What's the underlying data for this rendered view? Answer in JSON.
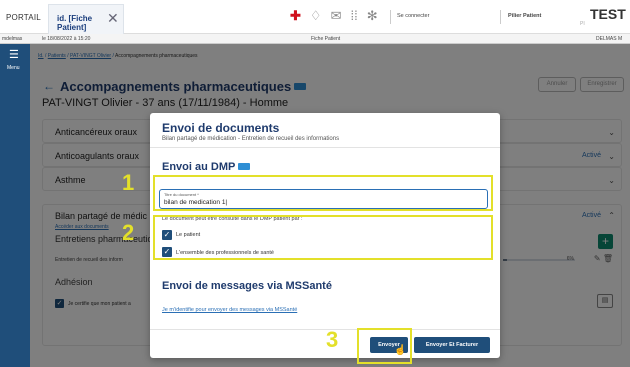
{
  "top": {
    "portail": "PORTAIL",
    "tab_label": "id. [Fiche Patient]",
    "connect": "Se connecter",
    "pilier": "Pilier Patient",
    "brand": "TEST",
    "brand_sub": "PI"
  },
  "strip": {
    "user": "mdelmas",
    "date": "le 18/08/2022 à 15:20",
    "center": "Fiche Patient",
    "right": "DELMAS M"
  },
  "sidebar": {
    "menu_label": "Menu"
  },
  "breadcrumb": {
    "id": "Id.",
    "patients": "Patients",
    "patient": "PAT-VINGT Olivier",
    "current": "Accompagnements pharmaceutiques"
  },
  "page": {
    "title": "Accompagnements pharmaceutiques",
    "patient": "PAT-VINGT Olivier - 37 ans (17/11/1984) - Homme",
    "annuler": "Annuler",
    "enregistrer": "Enregistrer"
  },
  "cards": [
    {
      "title": "Anticancéreux oraux",
      "status": ""
    },
    {
      "title": "Anticoagulants oraux",
      "status": "Activé"
    },
    {
      "title": "Asthme",
      "status": ""
    },
    {
      "title": "Bilan partagé de médic",
      "status": "Activé"
    }
  ],
  "bilan": {
    "acceder": "Accéder aux documents",
    "entretiens": "Entretiens pharmaceutiqu",
    "entretien_row": "Entretien de recueil des inform",
    "progress_percent": 6,
    "pct_label": "6%",
    "adhesion": "Adhésion",
    "certify": "Je certifie que mon patient a"
  },
  "modal": {
    "title": "Envoi de documents",
    "subtitle": "Bilan partagé de médication - Entretien de recueil des informations",
    "dmp_title": "Envoi au DMP",
    "field_label": "Titre du document *",
    "field_value": "bilan de medication 1|",
    "consult_text": "Le document peut être consulté dans le DMP patient par :",
    "opt_patient": "Le patient",
    "opt_pros": "L'ensemble des professionnels de santé",
    "mss_title": "Envoi de messages via MSSanté",
    "mss_link": "Je m'identifie pour envoyer des messages via MSSanté",
    "send": "Envoyer",
    "send_invoice": "Envoyer Et Facturer"
  },
  "annotations": [
    "1",
    "2",
    "3"
  ],
  "colors": {
    "brand": "#1f4e7a",
    "accent": "#2a6fb5",
    "highlight": "#e3e02a",
    "green": "#0c8a6e"
  }
}
